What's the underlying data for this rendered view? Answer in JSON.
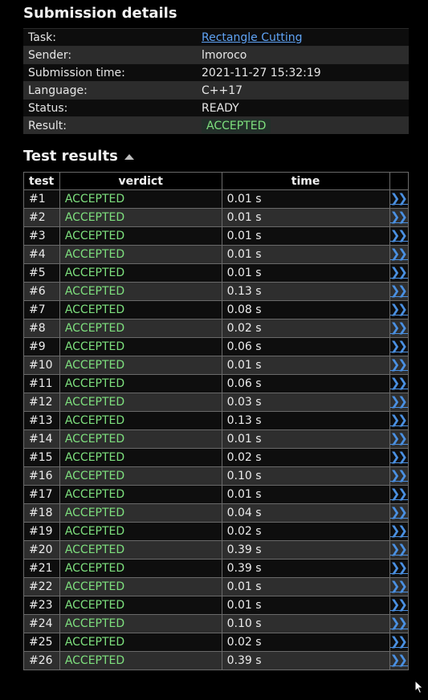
{
  "details": {
    "title": "Submission details",
    "rows": [
      {
        "label": "Task:",
        "value": "Rectangle Cutting",
        "link": true
      },
      {
        "label": "Sender:",
        "value": "lmoroco"
      },
      {
        "label": "Submission time:",
        "value": "2021-11-27 15:32:19"
      },
      {
        "label": "Language:",
        "value": "C++17"
      },
      {
        "label": "Status:",
        "value": "READY"
      },
      {
        "label": "Result:",
        "value": "ACCEPTED",
        "badge": true
      }
    ]
  },
  "tests": {
    "title": "Test results",
    "headers": {
      "test": "test",
      "verdict": "verdict",
      "time": "time"
    },
    "link_icon": "double-chevron-right-icon",
    "rows": [
      {
        "test": "#1",
        "verdict": "ACCEPTED",
        "time": "0.01 s"
      },
      {
        "test": "#2",
        "verdict": "ACCEPTED",
        "time": "0.01 s"
      },
      {
        "test": "#3",
        "verdict": "ACCEPTED",
        "time": "0.01 s"
      },
      {
        "test": "#4",
        "verdict": "ACCEPTED",
        "time": "0.01 s"
      },
      {
        "test": "#5",
        "verdict": "ACCEPTED",
        "time": "0.01 s"
      },
      {
        "test": "#6",
        "verdict": "ACCEPTED",
        "time": "0.13 s"
      },
      {
        "test": "#7",
        "verdict": "ACCEPTED",
        "time": "0.08 s"
      },
      {
        "test": "#8",
        "verdict": "ACCEPTED",
        "time": "0.02 s"
      },
      {
        "test": "#9",
        "verdict": "ACCEPTED",
        "time": "0.06 s"
      },
      {
        "test": "#10",
        "verdict": "ACCEPTED",
        "time": "0.01 s"
      },
      {
        "test": "#11",
        "verdict": "ACCEPTED",
        "time": "0.06 s"
      },
      {
        "test": "#12",
        "verdict": "ACCEPTED",
        "time": "0.03 s"
      },
      {
        "test": "#13",
        "verdict": "ACCEPTED",
        "time": "0.13 s"
      },
      {
        "test": "#14",
        "verdict": "ACCEPTED",
        "time": "0.01 s"
      },
      {
        "test": "#15",
        "verdict": "ACCEPTED",
        "time": "0.02 s"
      },
      {
        "test": "#16",
        "verdict": "ACCEPTED",
        "time": "0.10 s"
      },
      {
        "test": "#17",
        "verdict": "ACCEPTED",
        "time": "0.01 s"
      },
      {
        "test": "#18",
        "verdict": "ACCEPTED",
        "time": "0.04 s"
      },
      {
        "test": "#19",
        "verdict": "ACCEPTED",
        "time": "0.02 s"
      },
      {
        "test": "#20",
        "verdict": "ACCEPTED",
        "time": "0.39 s"
      },
      {
        "test": "#21",
        "verdict": "ACCEPTED",
        "time": "0.39 s"
      },
      {
        "test": "#22",
        "verdict": "ACCEPTED",
        "time": "0.01 s"
      },
      {
        "test": "#23",
        "verdict": "ACCEPTED",
        "time": "0.01 s"
      },
      {
        "test": "#24",
        "verdict": "ACCEPTED",
        "time": "0.10 s"
      },
      {
        "test": "#25",
        "verdict": "ACCEPTED",
        "time": "0.02 s"
      },
      {
        "test": "#26",
        "verdict": "ACCEPTED",
        "time": "0.39 s"
      }
    ]
  },
  "colors": {
    "accepted": "#7ee07e",
    "link": "#5fa3f5",
    "background": "#000000"
  }
}
